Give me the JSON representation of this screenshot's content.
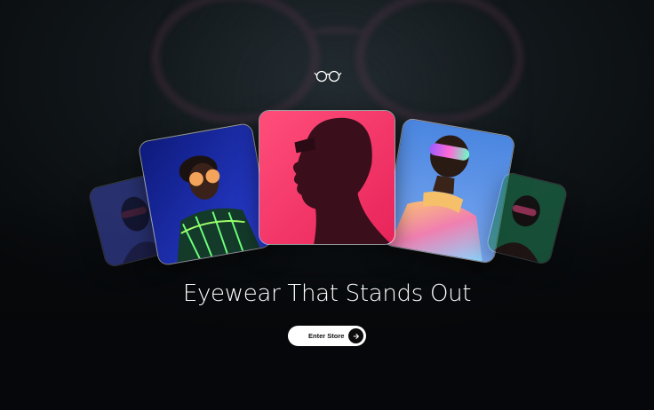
{
  "hero": {
    "headline": "Eyewear That Stands Out",
    "cta_label": "Enter Store"
  },
  "icons": {
    "logo": "glasses-icon",
    "cta": "arrow-right-icon"
  },
  "gallery": {
    "cards": [
      {
        "subject": "blue-portrait",
        "tint": "#3f4bb8"
      },
      {
        "subject": "neon-jacket-portrait",
        "tint": "#1b2b9a"
      },
      {
        "subject": "pink-silhouette-portrait",
        "tint": "#f0356b"
      },
      {
        "subject": "holographic-portrait",
        "tint": "#4f7fd8"
      },
      {
        "subject": "green-portrait",
        "tint": "#1f7a52"
      }
    ]
  },
  "colors": {
    "background": "#07090b",
    "button_bg": "#ffffff",
    "text": "#ffffff"
  }
}
